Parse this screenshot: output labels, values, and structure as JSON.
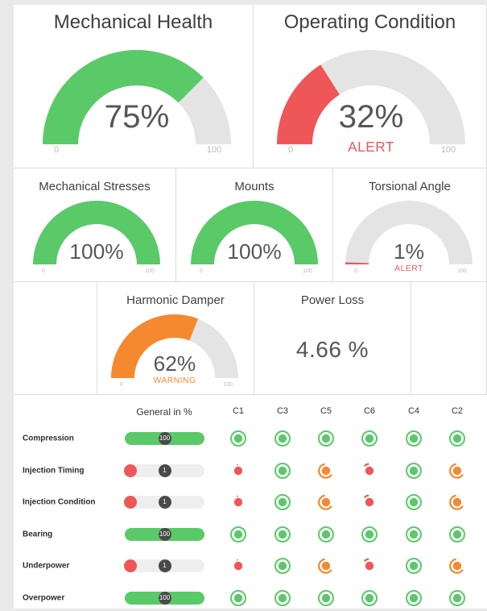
{
  "colors": {
    "green": "#5ac968",
    "red": "#ee5657",
    "orange": "#f5892f",
    "track": "#e4e4e4"
  },
  "gauges": {
    "mechanical_health": {
      "title": "Mechanical Health",
      "value": 75,
      "display": "75%",
      "status": "",
      "min_label": "0",
      "max_label": "100",
      "color": "#5ac968"
    },
    "operating_condition": {
      "title": "Operating Condition",
      "value": 32,
      "display": "32%",
      "status": "ALERT",
      "min_label": "0",
      "max_label": "100",
      "color": "#ee5657"
    },
    "mechanical_stresses": {
      "title": "Mechanical Stresses",
      "value": 100,
      "display": "100%",
      "status": "",
      "min_label": "0",
      "max_label": "100",
      "color": "#5ac968"
    },
    "mounts": {
      "title": "Mounts",
      "value": 100,
      "display": "100%",
      "status": "",
      "min_label": "0",
      "max_label": "100",
      "color": "#5ac968"
    },
    "torsional_angle": {
      "title": "Torsional Angle",
      "value": 1,
      "display": "1%",
      "status": "ALERT",
      "min_label": "0",
      "max_label": "100",
      "color": "#ee5657"
    },
    "harmonic_damper": {
      "title": "Harmonic Damper",
      "value": 62,
      "display": "62%",
      "status": "WARNING",
      "min_label": "0",
      "max_label": "100",
      "color": "#f5892f"
    }
  },
  "power_loss": {
    "title": "Power Loss",
    "value": "4.66 %"
  },
  "matrix": {
    "general_header": "General in %",
    "columns": [
      "C1",
      "C3",
      "C5",
      "C6",
      "C4",
      "C2"
    ],
    "rows": [
      {
        "label": "Compression",
        "general": 100,
        "general_label": "100",
        "cells": [
          "ok",
          "ok",
          "ok",
          "ok",
          "ok",
          "ok"
        ]
      },
      {
        "label": "Injection Timing",
        "general": 1,
        "general_label": "1",
        "cells": [
          "fault",
          "ok",
          "warn",
          "alert",
          "ok",
          "warn"
        ]
      },
      {
        "label": "Injection Condition",
        "general": 1,
        "general_label": "1",
        "cells": [
          "fault",
          "ok",
          "warn",
          "alert",
          "ok",
          "warn"
        ]
      },
      {
        "label": "Bearing",
        "general": 100,
        "general_label": "100",
        "cells": [
          "ok",
          "ok",
          "ok",
          "ok",
          "ok",
          "ok"
        ]
      },
      {
        "label": "Underpower",
        "general": 1,
        "general_label": "1",
        "cells": [
          "fault",
          "ok",
          "warn",
          "alert",
          "ok",
          "warn"
        ]
      },
      {
        "label": "Overpower",
        "general": 100,
        "general_label": "100",
        "cells": [
          "ok",
          "ok",
          "ok",
          "ok",
          "ok",
          "ok"
        ]
      }
    ]
  }
}
